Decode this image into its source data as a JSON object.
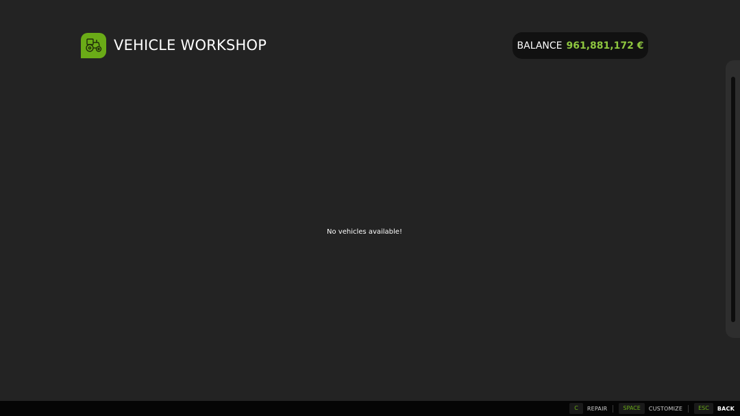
{
  "header": {
    "icon": "tractor-icon",
    "title": "VEHICLE WORKSHOP"
  },
  "balance": {
    "label": "BALANCE",
    "value": "961,881,172 €"
  },
  "main": {
    "empty_message": "No vehicles available!"
  },
  "footer": {
    "actions": [
      {
        "key": "C",
        "label": "REPAIR"
      },
      {
        "key": "SPACE",
        "label": "CUSTOMIZE"
      },
      {
        "key": "ESC",
        "label": "BACK"
      }
    ]
  },
  "colors": {
    "accent": "#6aab17",
    "balance_value": "#8ec63f",
    "background": "#232323",
    "footer": "#050505"
  }
}
